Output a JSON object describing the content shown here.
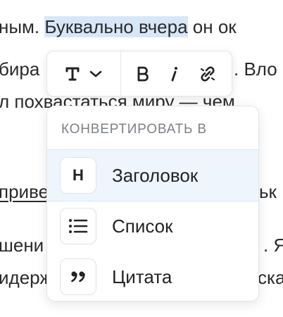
{
  "editor": {
    "line1_pre": "ным. ",
    "line1_selected": "Буквально вчера",
    "line1_post": " он ок",
    "line2_pre": "бира",
    "line2_post": ". Вло",
    "line3": "л похвастаться миру — чем",
    "line4_link": "приве",
    "line4_post": "ьк",
    "line5_pre": "шени",
    "line5_post": ". Я",
    "line6_pre": "идерж",
    "line6_post": "ска"
  },
  "toolbar": {
    "icons": [
      "text-type-icon",
      "chevron-down-icon",
      "bold-icon",
      "italic-icon",
      "link-icon"
    ]
  },
  "convert_menu": {
    "title": "КОНВЕРТИРОВАТЬ В",
    "items": [
      {
        "label": "Заголовок",
        "icon_text": "H",
        "icon": "heading-icon",
        "active": true
      },
      {
        "label": "Список",
        "icon": "list-icon",
        "active": false
      },
      {
        "label": "Цитата",
        "icon_text": "”",
        "icon": "quote-icon",
        "active": false
      }
    ]
  },
  "colors": {
    "selection": "#d7e7f8",
    "active_item": "#eef5fc",
    "muted_text": "#7b8088"
  }
}
